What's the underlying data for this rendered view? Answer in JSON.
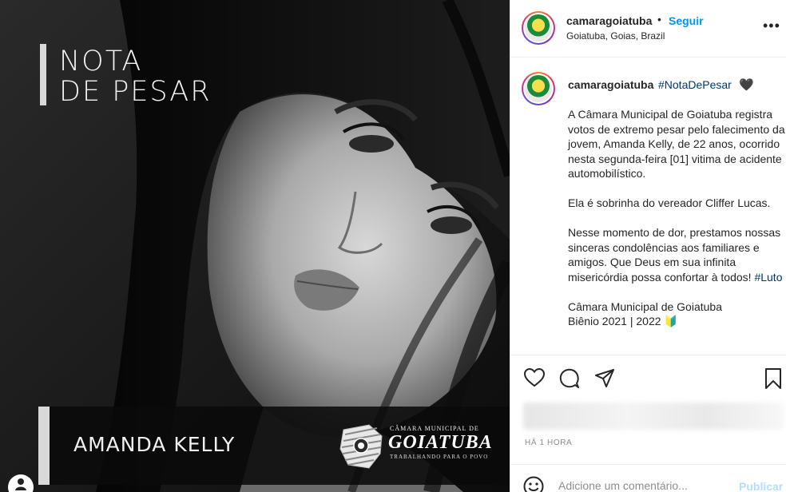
{
  "image": {
    "title_line1": "NOTA",
    "title_line2": "DE PESAR",
    "name": "AMANDA KELLY",
    "logo": {
      "line1": "CÂMARA MUNICIPAL DE",
      "line2": "GOIATUBA",
      "line3": "TRABALHANDO PARA O POVO"
    }
  },
  "header": {
    "username": "camaragoiatuba",
    "separator": "•",
    "follow_label": "Seguir",
    "location": "Goiatuba, Goias, Brazil",
    "more_icon": "more-horizontal-icon"
  },
  "caption": {
    "username": "camaragoiatuba",
    "hashtag": "#NotaDePesar",
    "heart": "🖤",
    "paragraph1": "A Câmara Municipal de Goiatuba registra votos de extremo pesar pelo falecimento da jovem, Amanda Kelly, de 22 anos, ocorrido nesta segunda-feira [01] vitima de acidente automobilístico.",
    "paragraph2": "Ela é sobrinha do vereador Cliffer Lucas.",
    "paragraph3": "Nesse momento de dor, prestamos nossas sinceras condolências aos familiares e amigos. Que Deus em sua infinita misericórdia possa confortar à todos!",
    "hashtag2": "#Luto",
    "signature1": "Câmara Municipal de Goiatuba",
    "signature2": "Biênio 2021 | 2022",
    "signature_emoji": "🔰"
  },
  "actions": {
    "icons": [
      "heart-icon",
      "comment-icon",
      "share-icon",
      "bookmark-icon"
    ]
  },
  "timestamp": "HÁ 1 HORA",
  "comment": {
    "placeholder": "Adicione um comentário...",
    "publish_label": "Publicar"
  },
  "colors": {
    "link": "#0095f6",
    "hashtag": "#00376b",
    "text": "#262626",
    "muted": "#8e8e8e",
    "publish_disabled": "#b2dffc"
  }
}
